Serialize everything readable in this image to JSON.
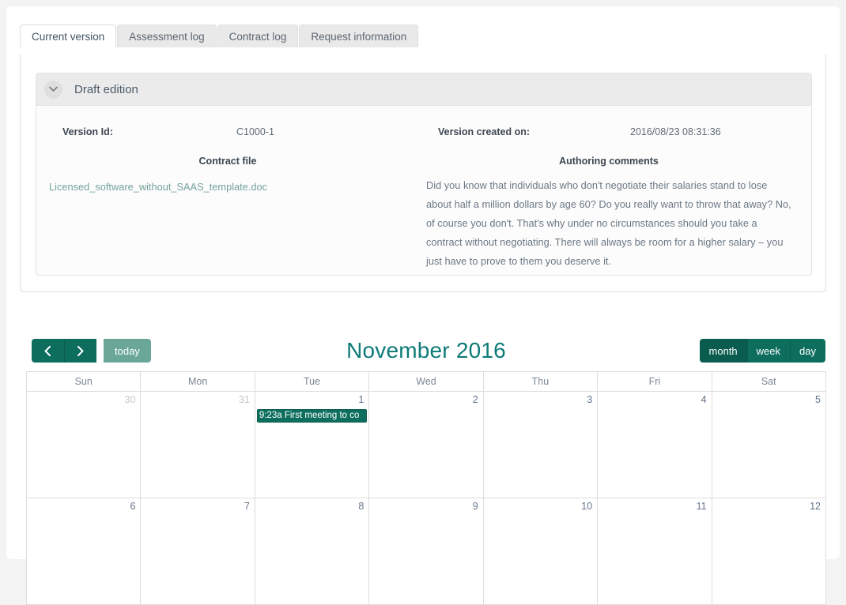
{
  "tabs": [
    {
      "label": "Current version",
      "active": true
    },
    {
      "label": "Assessment log",
      "active": false
    },
    {
      "label": "Contract log",
      "active": false
    },
    {
      "label": "Request information",
      "active": false
    }
  ],
  "panel": {
    "title": "Draft edition",
    "version_id_label": "Version Id:",
    "version_id_value": "C1000-1",
    "version_created_label": "Version created on:",
    "version_created_value": "2016/08/23 08:31:36",
    "contract_file_heading": "Contract file",
    "contract_file_name": "Licensed_software_without_SAAS_template.doc",
    "authoring_comments_heading": "Authoring comments",
    "authoring_comments_text": "Did you know that individuals who don't negotiate their salaries stand to lose about half a million dollars by age 60? Do you really want to throw that away? No, of course you don't. That's why under no circumstances should you take a contract without negotiating. There will always be room for a higher salary – you just have to prove to them you deserve it."
  },
  "calendar": {
    "title": "November 2016",
    "prev_label": "‹",
    "next_label": "›",
    "today_label": "today",
    "views": [
      {
        "label": "month",
        "active": true
      },
      {
        "label": "week",
        "active": false
      },
      {
        "label": "day",
        "active": false
      }
    ],
    "day_headers": [
      "Sun",
      "Mon",
      "Tue",
      "Wed",
      "Thu",
      "Fri",
      "Sat"
    ],
    "weeks": [
      [
        {
          "num": "30",
          "other": true
        },
        {
          "num": "31",
          "other": true
        },
        {
          "num": "1",
          "other": false,
          "event": {
            "time": "9:23a",
            "title": "First meeting to co"
          }
        },
        {
          "num": "2",
          "other": false
        },
        {
          "num": "3",
          "other": false
        },
        {
          "num": "4",
          "other": false
        },
        {
          "num": "5",
          "other": false
        }
      ],
      [
        {
          "num": "6",
          "other": false
        },
        {
          "num": "7",
          "other": false
        },
        {
          "num": "8",
          "other": false
        },
        {
          "num": "9",
          "other": false
        },
        {
          "num": "10",
          "other": false
        },
        {
          "num": "11",
          "other": false
        },
        {
          "num": "12",
          "other": false
        }
      ]
    ]
  },
  "colors": {
    "accent_dark_teal": "#0d6e5e",
    "accent_light_teal": "#6aa799",
    "title_teal": "#0d7b77",
    "link_teal": "#74a39b",
    "page_bg": "#f3f3f3"
  }
}
